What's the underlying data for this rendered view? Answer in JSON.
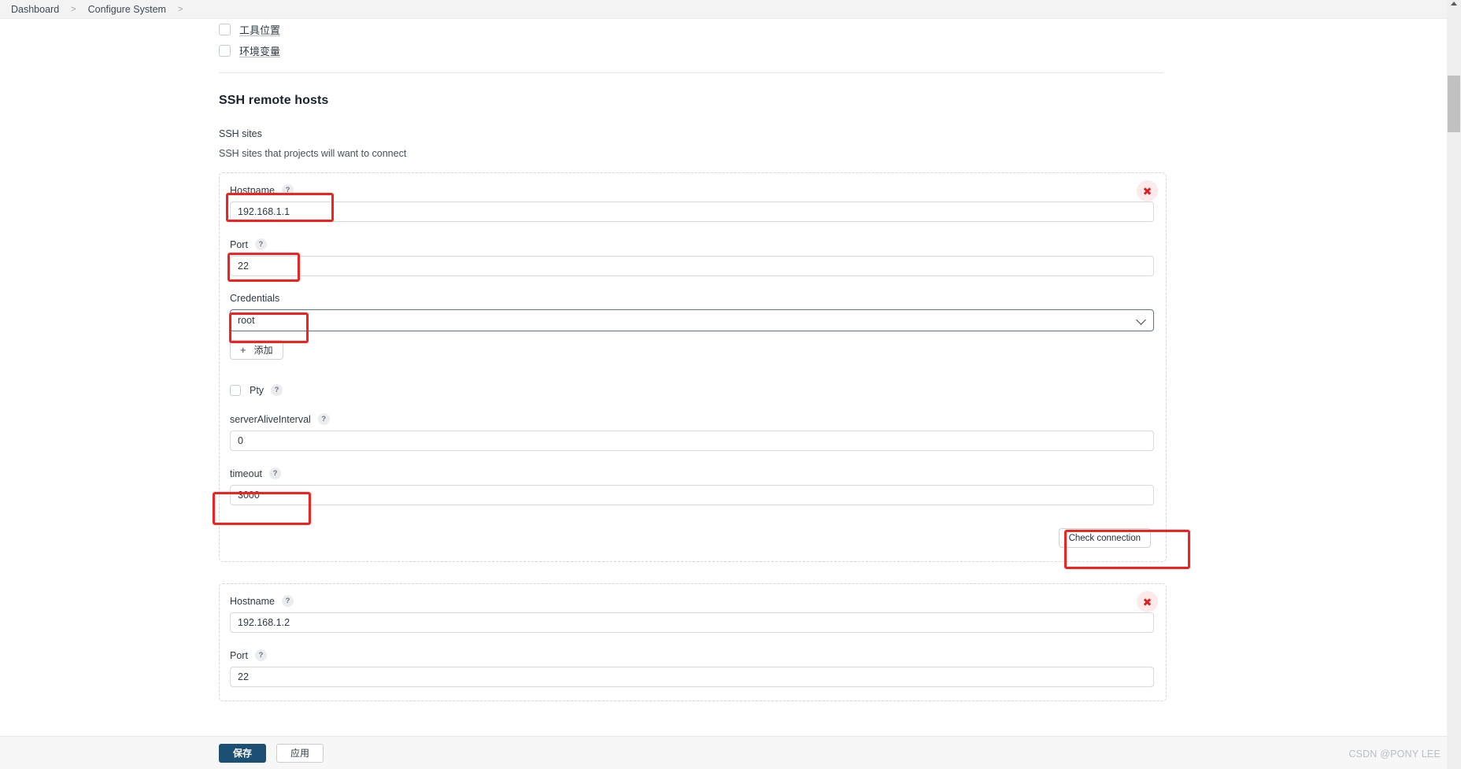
{
  "breadcrumb": {
    "items": [
      "Dashboard",
      "Configure System"
    ],
    "separator": ">"
  },
  "checkboxes": [
    {
      "label": "工具位置",
      "checked": false
    },
    {
      "label": "环境变量",
      "checked": false
    }
  ],
  "section": {
    "title": "SSH remote hosts",
    "field_label": "SSH sites",
    "field_desc": "SSH sites that projects will want to connect"
  },
  "labels": {
    "hostname": "Hostname",
    "port": "Port",
    "credentials": "Credentials",
    "pty": "Pty",
    "server_alive_interval": "serverAliveInterval",
    "timeout": "timeout",
    "help_glyph": "?",
    "add_button": "添加",
    "add_plus": "+",
    "check_connection": "Check connection",
    "delete_glyph": "✖"
  },
  "sites": [
    {
      "hostname": "192.168.1.1",
      "port": "22",
      "credentials": "root",
      "credentials_options": [
        "root"
      ],
      "pty_checked": false,
      "server_alive_interval": "0",
      "timeout": "3000"
    },
    {
      "hostname": "192.168.1.2",
      "port": "22"
    }
  ],
  "footer": {
    "save": "保存",
    "apply": "应用"
  },
  "watermark": "CSDN @PONY LEE",
  "colors": {
    "accent": "#1b4f73",
    "annotation": "#f42121",
    "delete": "#e02020",
    "select_border": "#5d7682"
  }
}
